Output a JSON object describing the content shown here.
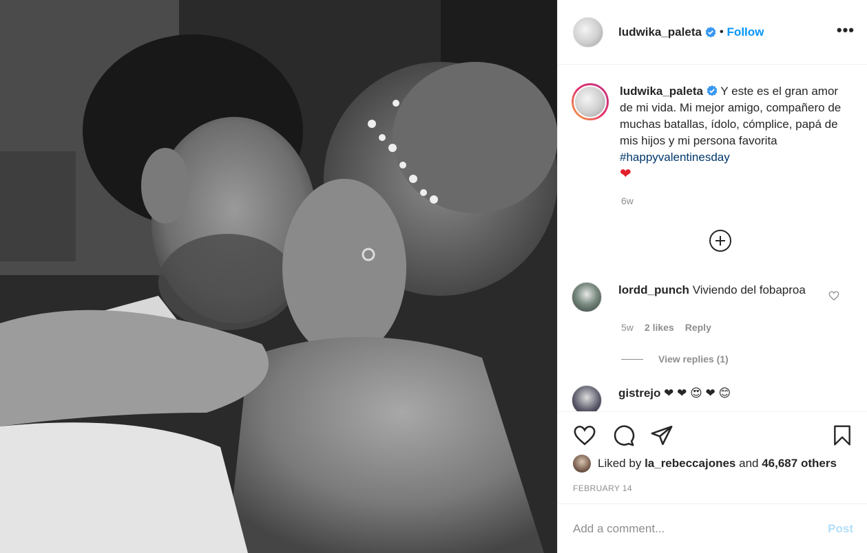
{
  "post": {
    "author": "ludwika_paleta",
    "follow_label": "Follow",
    "separator": "•",
    "more_label": "•••",
    "image_alt": "Black and white photo of a couple embracing",
    "caption": {
      "username": "ludwika_paleta",
      "text": "Y este es el gran amor de mi vida. Mi mejor amigo, compañero de muchas batallas, ídolo, cómplice, papá de mis hijos y mi persona favorita",
      "hashtag": "#happyvalentinesday",
      "emoji": "❤",
      "time": "6w"
    },
    "load_more_icon": "plus-circle-icon",
    "comments": [
      {
        "username": "lordd_punch",
        "text": "Viviendo del fobaproa",
        "time": "5w",
        "likes": "2 likes",
        "reply_label": "Reply",
        "view_replies": "View replies (1)"
      },
      {
        "username": "gistrejo",
        "text": "❤ ❤ 😍 ❤ 😊"
      }
    ],
    "liked_by_prefix": "Liked by",
    "liked_by_user": "la_rebeccajones",
    "liked_by_and": "and",
    "liked_by_others": "46,687 others",
    "date": "FEBRUARY 14",
    "add_comment_placeholder": "Add a comment...",
    "post_label": "Post"
  },
  "colors": {
    "accent": "#0095f6",
    "hashtag": "#00376b",
    "muted": "#8e8e8e",
    "post_disabled": "#b2dffc",
    "heart": "#e0202a"
  }
}
